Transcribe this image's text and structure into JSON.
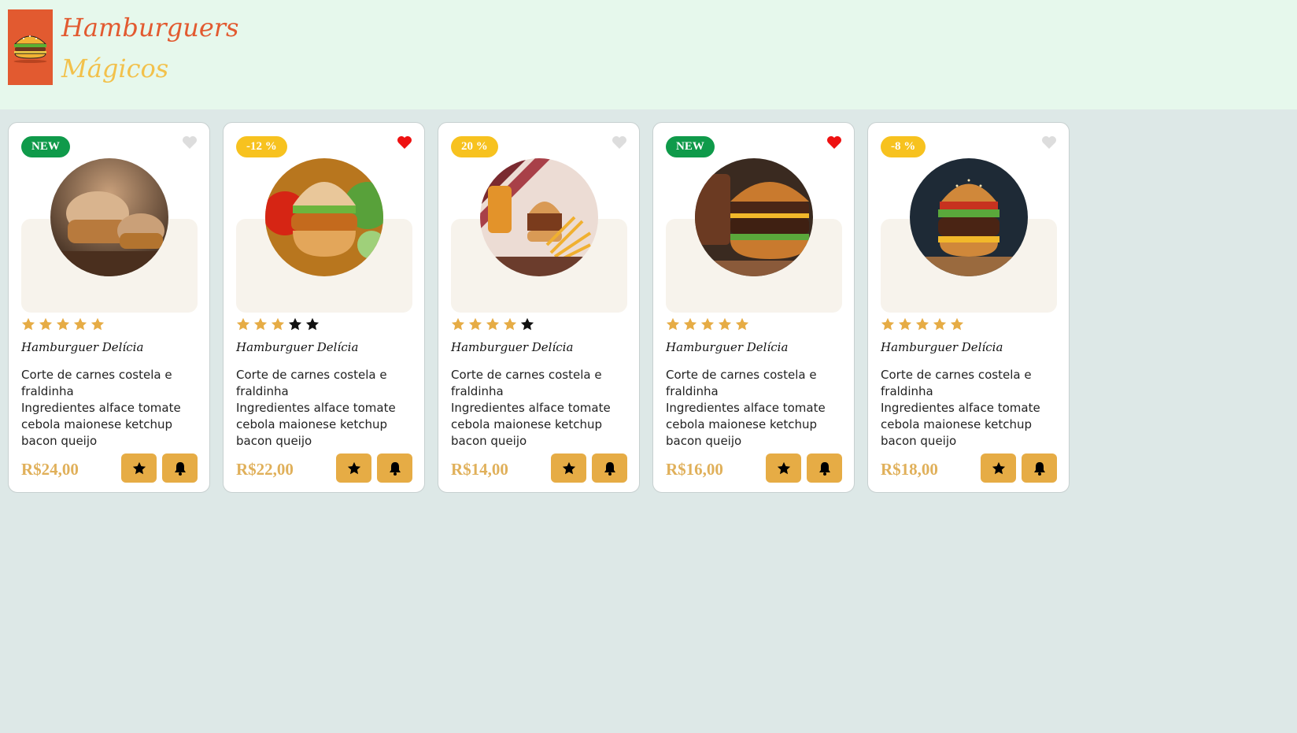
{
  "brand": {
    "line1": "Hamburguers",
    "line2": "Mágicos"
  },
  "colors": {
    "accent": "#e25a30",
    "accent_yellow": "#f2c14b",
    "button": "#e6ac45",
    "price": "#e0b05a",
    "star_filled": "#e6ac45",
    "star_empty": "#111111",
    "heart_active": "#ee1111",
    "heart_inactive": "#dddddd",
    "badge_new": "#0f9a4a",
    "badge_discount": "#f7c21f"
  },
  "products": [
    {
      "badge": "NEW",
      "badge_type": "green",
      "favorited": false,
      "rating": 5,
      "title": "Hamburguer Delícia",
      "desc_line1": "Corte de carnes costela e fraldinha",
      "desc_line2": "Ingredientes alface tomate cebola maionese ketchup bacon queijo",
      "price": "R$24,00",
      "image": "chicken-burger-photo"
    },
    {
      "badge": "-12 %",
      "badge_type": "yellow",
      "favorited": true,
      "rating": 3,
      "title": "Hamburguer Delícia",
      "desc_line1": "Corte de carnes costela e fraldinha",
      "desc_line2": "Ingredientes alface tomate cebola maionese ketchup bacon queijo",
      "price": "R$22,00",
      "image": "burger-with-tomato-photo"
    },
    {
      "badge": "20 %",
      "badge_type": "yellow",
      "favorited": false,
      "rating": 4,
      "title": "Hamburguer Delícia",
      "desc_line1": "Corte de carnes costela e fraldinha",
      "desc_line2": "Ingredientes alface tomate cebola maionese ketchup bacon queijo",
      "price": "R$14,00",
      "image": "burger-fries-beer-photo"
    },
    {
      "badge": "NEW",
      "badge_type": "green",
      "favorited": true,
      "rating": 5,
      "title": "Hamburguer Delícia",
      "desc_line1": "Corte de carnes costela e fraldinha",
      "desc_line2": "Ingredientes alface tomate cebola maionese ketchup bacon queijo",
      "price": "R$16,00",
      "image": "double-cheeseburger-photo"
    },
    {
      "badge": "-8 %",
      "badge_type": "yellow",
      "favorited": false,
      "rating": 5,
      "title": "Hamburguer Delícia",
      "desc_line1": "Corte de carnes costela e fraldinha",
      "desc_line2": "Ingredientes alface tomate cebola maionese ketchup bacon queijo",
      "price": "R$18,00",
      "image": "cheeseburger-on-board-photo"
    }
  ]
}
